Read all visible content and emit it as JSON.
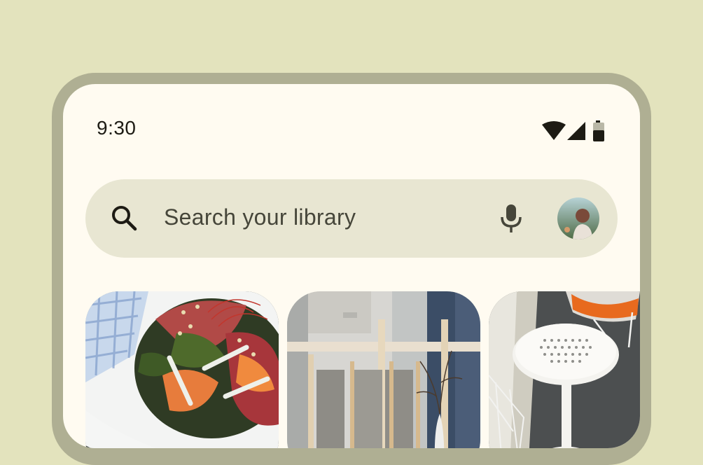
{
  "status_bar": {
    "time": "9:30",
    "icons": [
      "wifi-icon",
      "cellular-signal-icon",
      "battery-icon"
    ]
  },
  "search": {
    "placeholder": "Search your library",
    "leading_icon": "search-icon",
    "trailing_icons": [
      "mic-icon",
      "account-avatar"
    ]
  },
  "photos": [
    {
      "subject": "sashimi salad in bowl"
    },
    {
      "subject": "interior with wooden frames and vase"
    },
    {
      "subject": "white patio table and orange chairs"
    }
  ],
  "colors": {
    "background": "#e3e3bd",
    "frame": "#afaf93",
    "screen": "#fffbf1",
    "search_bar": "#e8e6d2",
    "text": "#1d1b14"
  }
}
